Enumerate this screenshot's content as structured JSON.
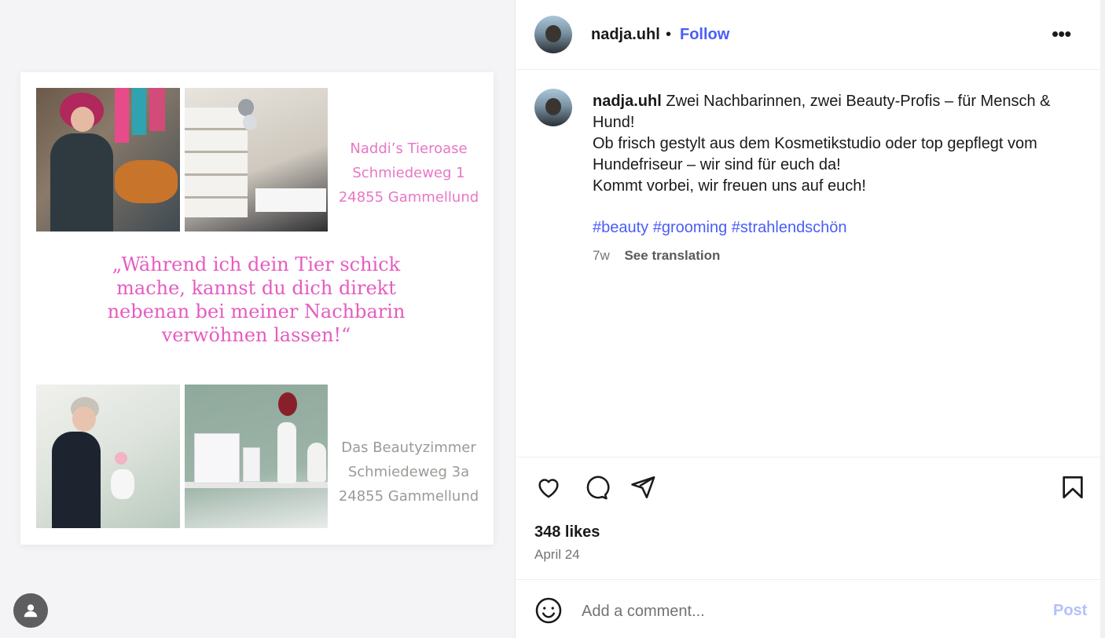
{
  "post_image": {
    "address_top": [
      "Naddi’s Tieroase",
      "Schmiedeweg 1",
      "24855 Gammellund"
    ],
    "quote": [
      "„Während ich dein Tier schick",
      "mache, kannst du dich direkt",
      "nebenan bei meiner Nachbarin",
      "verwöhnen lassen!“"
    ],
    "address_bottom": [
      "Das Beautyzimmer",
      "Schmiedeweg 3a",
      "24855 Gammellund"
    ]
  },
  "header": {
    "username": "nadja.uhl",
    "separator": "•",
    "follow_label": "Follow",
    "more_label": "•••"
  },
  "caption": {
    "username": "nadja.uhl",
    "lines": [
      "Zwei Nachbarinnen, zwei Beauty-Profis – für Mensch &",
      "Hund!",
      "Ob frisch gestylt aus dem Kosmetikstudio oder top gepflegt vom",
      "Hundefriseur – wir sind für euch da!",
      "Kommt vorbei, wir freuen uns auf euch!"
    ],
    "hashtags": "#beauty #grooming #strahlendschön",
    "age": "7w",
    "see_translation": "See translation"
  },
  "actions": {
    "likes": "348 likes",
    "date": "April 24"
  },
  "comment": {
    "placeholder": "Add a comment...",
    "post_label": "Post"
  },
  "colors": {
    "accent": "#4a5df9",
    "post_disabled": "#b3c0fd",
    "pink_text": "#e877c4",
    "grey_text": "#9b9a96"
  }
}
